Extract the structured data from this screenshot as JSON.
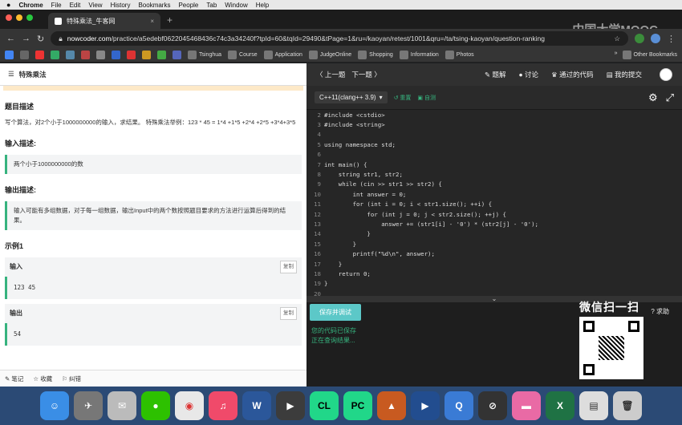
{
  "menubar": {
    "apple": "",
    "app": "Chrome",
    "items": [
      "File",
      "Edit",
      "View",
      "History",
      "Bookmarks",
      "People",
      "Tab",
      "Window",
      "Help"
    ]
  },
  "browser": {
    "tab_title": "特殊乘法_牛客网",
    "tab_close": "×",
    "new_tab": "+",
    "url_host": "nowcoder.com",
    "url_path": "/practice/a5edebf0622045468436c74c3a34240f?tpId=60&tqId=29490&tPage=1&ru=/kaoyan/retest/1001&qru=/ta/tsing-kaoyan/question-ranking",
    "watermark": "中国大学MOOC"
  },
  "bookmarks": {
    "labels": [
      "Tsinghua",
      "Course",
      "Application",
      "JudgeOnline",
      "Shopping",
      "Information",
      "Photos"
    ],
    "other": "Other Bookmarks"
  },
  "problem": {
    "header": "特殊乘法",
    "desc_title": "题目描述",
    "desc": "写个算法，对2个小于1000000000的输入，求结果。 特殊乘法举例：123 * 45 = 1*4 +1*5 +2*4 +2*5 +3*4+3*5",
    "input_title": "输入描述:",
    "input_desc": "两个小于1000000000的数",
    "output_title": "输出描述:",
    "output_desc": "输入可能有多组数据，对于每一组数据，输出Input中的两个数按照题目要求的方法进行运算后得到的结果。",
    "example_title": "示例1",
    "in_label": "输入",
    "in_value": "123 45",
    "out_label": "输出",
    "out_value": "54",
    "copy": "复制",
    "footer": [
      "笔记",
      "收藏",
      "纠错"
    ]
  },
  "editor": {
    "nav_prev": "〈 上一题",
    "nav_next": "下一题 〉",
    "nav_items": [
      "题解",
      "讨论",
      "通过的代码",
      "我的提交"
    ],
    "lang": "C++11(clang++ 3.9)",
    "reset": "重置",
    "custom": "自测",
    "lines": [
      {
        "n": "2",
        "t": "#include <cstdio>"
      },
      {
        "n": "3",
        "t": "#include <string>"
      },
      {
        "n": "4",
        "t": ""
      },
      {
        "n": "5",
        "t": "using namespace std;"
      },
      {
        "n": "6",
        "t": ""
      },
      {
        "n": "7",
        "t": "int main() {"
      },
      {
        "n": "8",
        "t": "    string str1, str2;"
      },
      {
        "n": "9",
        "t": "    while (cin >> str1 >> str2) {"
      },
      {
        "n": "10",
        "t": "        int answer = 0;"
      },
      {
        "n": "11",
        "t": "        for (int i = 0; i < str1.size(); ++i) {"
      },
      {
        "n": "12",
        "t": "            for (int j = 0; j < str2.size(); ++j) {"
      },
      {
        "n": "13",
        "t": "                answer += (str1[i] - '0') * (str2[j] - '0');"
      },
      {
        "n": "14",
        "t": "            }"
      },
      {
        "n": "15",
        "t": "        }"
      },
      {
        "n": "16",
        "t": "        printf(\"%d\\n\", answer);"
      },
      {
        "n": "17",
        "t": "    }"
      },
      {
        "n": "18",
        "t": "    return 0;"
      },
      {
        "n": "19",
        "t": "}"
      },
      {
        "n": "20",
        "t": ""
      }
    ],
    "run_button": "保存并调试",
    "help": "求助",
    "status_saved": "您的代码已保存",
    "status_query": "正在查询结果..."
  },
  "qr": {
    "title": "微信扫一扫"
  }
}
